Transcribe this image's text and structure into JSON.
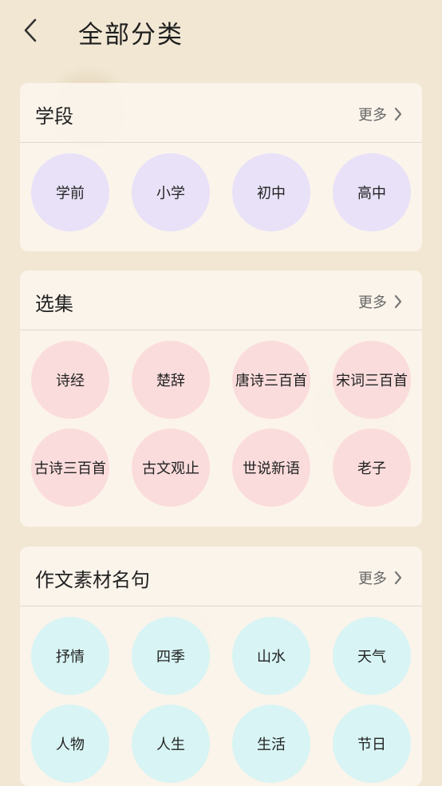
{
  "header": {
    "title": "全部分类"
  },
  "sections": [
    {
      "title": "学段",
      "more": "更多",
      "items": [
        "学前",
        "小学",
        "初中",
        "高中"
      ]
    },
    {
      "title": "选集",
      "more": "更多",
      "items": [
        "诗经",
        "楚辞",
        "唐诗三百首",
        "宋词三百首",
        "古诗三百首",
        "古文观止",
        "世说新语",
        "老子"
      ]
    },
    {
      "title": "作文素材名句",
      "more": "更多",
      "items": [
        "抒情",
        "四季",
        "山水",
        "天气",
        "人物",
        "人生",
        "生活",
        "节日"
      ]
    }
  ],
  "icons": {
    "back": "chevron-left-icon",
    "more": "chevron-right-icon"
  },
  "colors": {
    "stage": "#e8e1f8",
    "anthology": "#fbdcdc",
    "writing": "#d8f4f4",
    "background": "#f1e7d3"
  }
}
